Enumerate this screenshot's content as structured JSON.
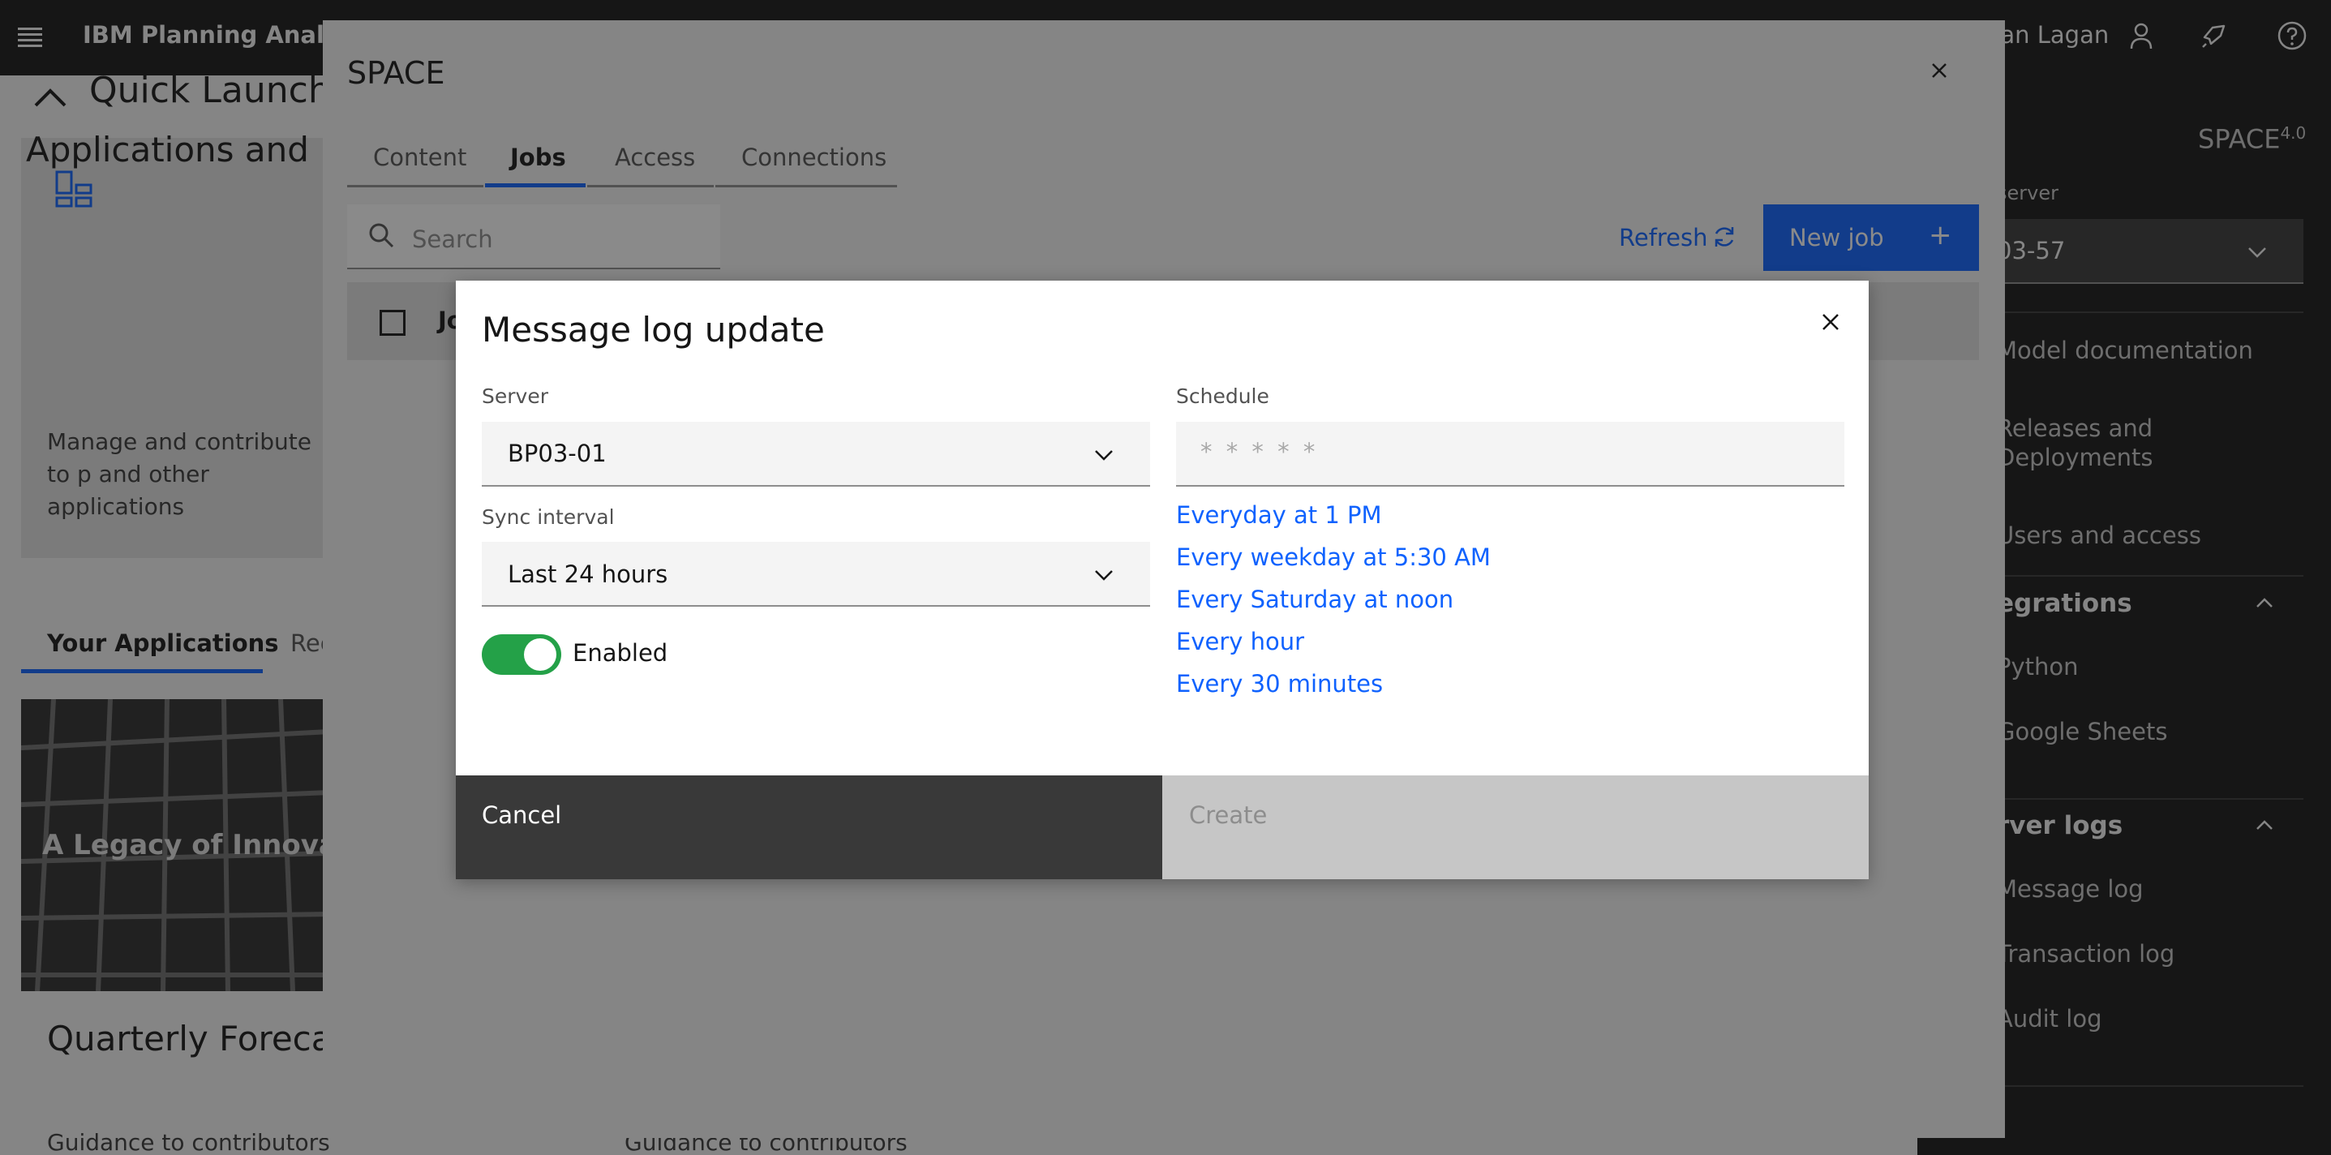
{
  "header": {
    "app_title": "IBM Planning Analytic",
    "user_name": "han Lagan"
  },
  "quick_launch": {
    "title": "Quick Launch",
    "apps_card": {
      "title": "Applications and P",
      "description": "Manage and contribute to p and other applications"
    },
    "tabs": [
      "Your Applications",
      "Rec"
    ],
    "image_card_text": "A Legacy of Innovatio",
    "forecast_title": "Quarterly Forecast",
    "guidance_1": "Guidance to contributors",
    "guidance_2": "Guidance to contributors"
  },
  "right_sidebar": {
    "space_name": "SPACE",
    "space_version": "4.0",
    "server_label": "server",
    "server_value": "03-57",
    "items_top": [
      "Model documentation",
      "Releases and",
      "Deployments",
      "Users and access"
    ],
    "integrations_title": "egrations",
    "integrations_items": [
      "Python",
      "Google Sheets"
    ],
    "server_logs_title": "rver logs",
    "server_logs_items": [
      "Message log",
      "Transaction log",
      "Audit log"
    ]
  },
  "space_panel": {
    "title": "SPACE",
    "tabs": [
      "Content",
      "Jobs",
      "Access",
      "Connections"
    ],
    "active_tab": "Jobs",
    "search_placeholder": "Search",
    "refresh_label": "Refresh",
    "new_job_label": "New job",
    "new_job_icon": "+",
    "table_first_column": "Jo"
  },
  "modal": {
    "title": "Message log update",
    "server_label": "Server",
    "server_value": "BP03-01",
    "sync_label": "Sync interval",
    "sync_value": "Last 24 hours",
    "enabled_label": "Enabled",
    "enabled": true,
    "schedule_label": "Schedule",
    "schedule_placeholder": "* * * * *",
    "schedule_presets": [
      "Everyday at 1 PM",
      "Every weekday at 5:30 AM",
      "Every Saturday at noon",
      "Every hour",
      "Every 30 minutes"
    ],
    "cancel_label": "Cancel",
    "create_label": "Create"
  },
  "colors": {
    "primary": "#0f62fe",
    "toggle_on": "#24a148",
    "header_bg": "#161616"
  },
  "icons": [
    "menu-icon",
    "user-icon",
    "rocket-icon",
    "help-icon",
    "close-icon",
    "search-icon",
    "refresh-icon",
    "chevron-down-icon",
    "chevron-up-icon",
    "apps-icon"
  ]
}
